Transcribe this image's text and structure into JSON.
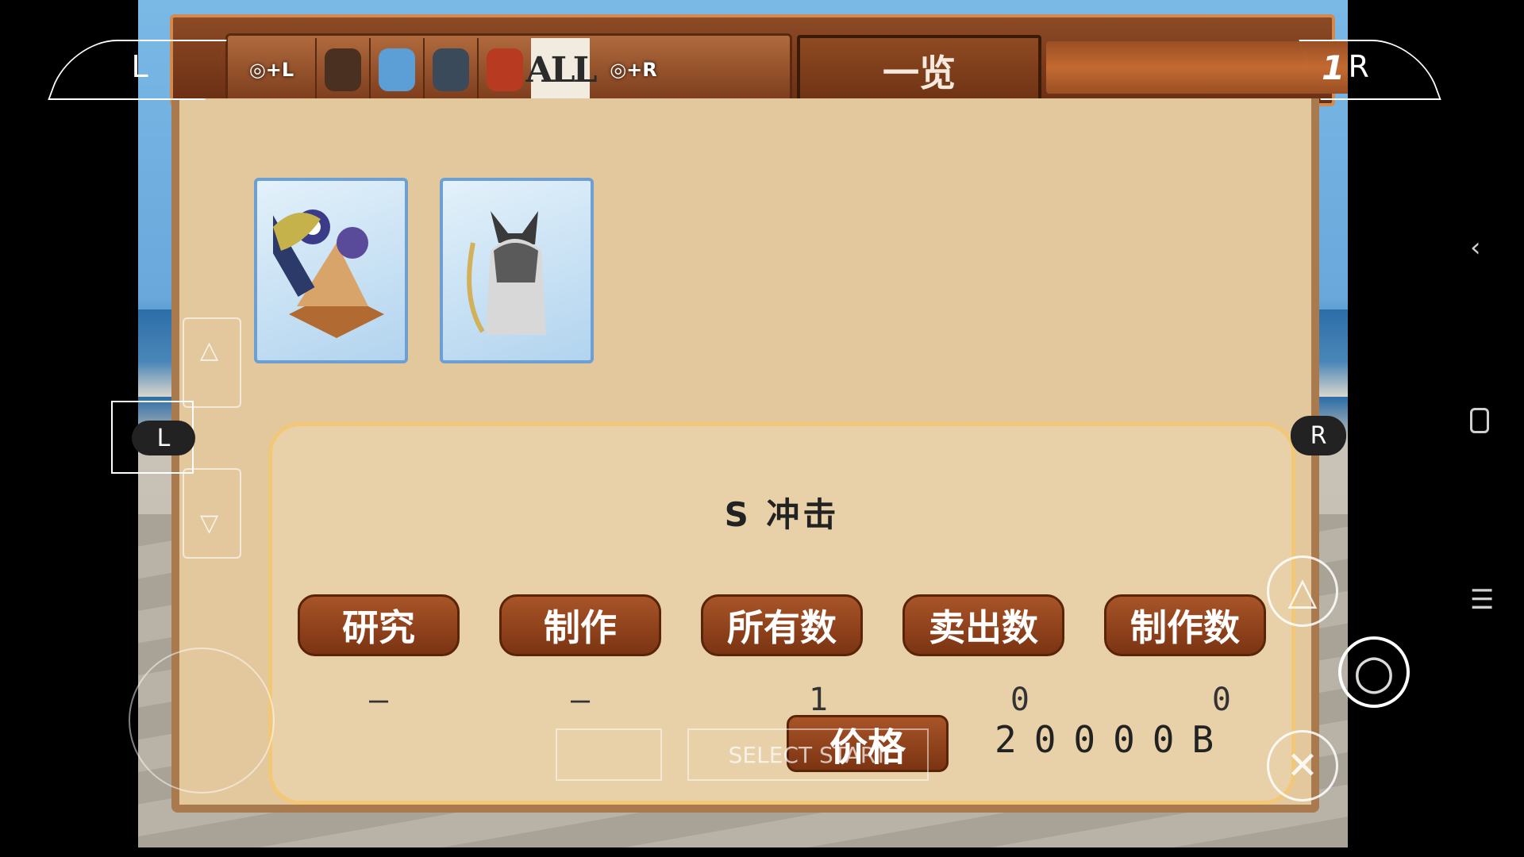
{
  "header": {
    "title": "一览",
    "page_indicator": "1 / 1",
    "prev_tab_hint": "◎+L",
    "next_tab_hint": "◎+R",
    "all_tab": "ALL"
  },
  "categories": [
    {
      "name": "bag-icon",
      "color": "#4a3020"
    },
    {
      "name": "potion-icon",
      "color": "#5b9fd6"
    },
    {
      "name": "gear-icon",
      "color": "#3a4a5a"
    },
    {
      "name": "book-icon",
      "color": "#b83a20"
    }
  ],
  "items": [
    {
      "name": "ship-cannon-model-icon"
    },
    {
      "name": "wolf-beast-portrait-icon"
    }
  ],
  "detail": {
    "item_name": "S 冲击",
    "stats": [
      {
        "label": "研究",
        "value": "—"
      },
      {
        "label": "制作",
        "value": "—"
      },
      {
        "label": "所有数",
        "value": "1"
      },
      {
        "label": "卖出数",
        "value": "0"
      },
      {
        "label": "制作数",
        "value": "0"
      }
    ],
    "price_label": "价格",
    "price_value": "20000B"
  },
  "overlay": {
    "l_shoulder": "L",
    "r_shoulder": "R",
    "l_small": "L",
    "r_small": "R",
    "select_start": "SELECT START"
  }
}
